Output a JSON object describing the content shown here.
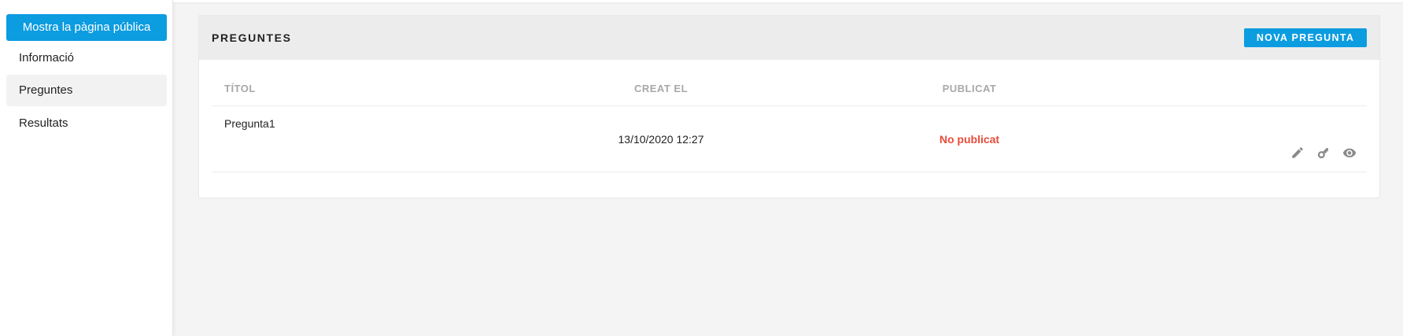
{
  "sidebar": {
    "public_button": "Mostra la pàgina pública",
    "items": [
      {
        "label": "Informació"
      },
      {
        "label": "Preguntes"
      },
      {
        "label": "Resultats"
      }
    ]
  },
  "panel": {
    "title": "PREGUNTES",
    "new_button": "NOVA PREGUNTA",
    "columns": [
      "TÍTOL",
      "CREAT EL",
      "PUBLICAT"
    ],
    "rows": [
      {
        "title": "Pregunta1",
        "created": "13/10/2020 12:27",
        "published": "No publicat"
      }
    ],
    "row_icons": [
      "pencil-icon",
      "key-icon",
      "eye-icon"
    ]
  },
  "colors": {
    "accent": "#0c9ce0",
    "unpublished": "#e74c3c",
    "background": "#f4f4f4"
  }
}
